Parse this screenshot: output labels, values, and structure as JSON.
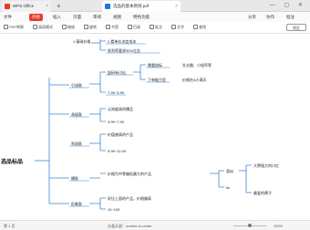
{
  "tabs": [
    {
      "label": "WPS Office",
      "close": "×"
    },
    {
      "label": "选品的基本原则.pdf",
      "close": "×"
    }
  ],
  "new_tab": "+",
  "window_controls": "— ▢ ✕",
  "menu": {
    "items": [
      "文件",
      "开始",
      "插入",
      "页面",
      "审阅",
      "视图",
      "特色功能"
    ],
    "active_index": 1,
    "right_items": [
      "分享",
      "协作",
      "批注"
    ]
  },
  "toolbar": {
    "items": [
      "PDF转换",
      "阅读模式",
      "缩放",
      "旋转",
      "书签",
      "目录",
      "批注",
      "文字",
      "查找"
    ],
    "lock_label": "锁定"
  },
  "mindmap": {
    "root": "选品标品",
    "nodes": {
      "n1": "2.看单价决定成本",
      "n2": "毛利率要求50%左右",
      "n3": "1.基础价格",
      "n4": "起码有讨论",
      "n5": "需重指标",
      "n6": "社交圈、小程序等",
      "n7": "下单能力型",
      "n8": "价格在A小满天",
      "n9": "引流款",
      "n10": "7.99~3.99",
      "n11": "承接款",
      "n12": "认知度高的爆品",
      "n13": "3.99~7.99",
      "n14": "利润款",
      "n15": "价值感高的产品",
      "n16": "5.99~11.99",
      "n17": "爆款",
      "n18": "价格为中等偏低最大的产品",
      "n19": "类似",
      "n20": "大牌强大的口红",
      "n21": "5c",
      "n22": "最爱的牌子",
      "n23": "形象款",
      "n24": "好比上面的产品，价格偏高",
      "n25": "10~100"
    }
  },
  "statusbar": {
    "page_info": "第 1 页",
    "doc_name": "水晶头部：mother-in-under",
    "zoom": "100%"
  }
}
